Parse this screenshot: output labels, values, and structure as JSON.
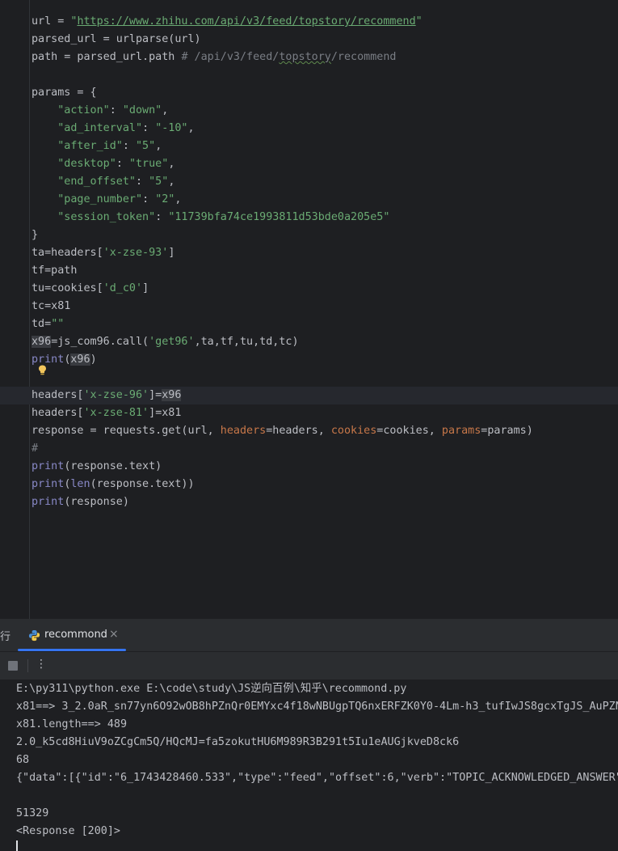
{
  "editor": {
    "url_var": "url",
    "url_value": "https://www.zhihu.com/api/v3/feed/topstory/recommend",
    "parse_call": "parsed_url = urlparse(url)",
    "path_assign": "path = parsed_url.path ",
    "path_comment_a": "# /api/v3/feed/",
    "path_comment_b": "topstory",
    "path_comment_c": "/recommend",
    "params_open": "params = {",
    "params": [
      {
        "key": "\"action\"",
        "value": "\"down\""
      },
      {
        "key": "\"ad_interval\"",
        "value": "\"-10\""
      },
      {
        "key": "\"after_id\"",
        "value": "\"5\""
      },
      {
        "key": "\"desktop\"",
        "value": "\"true\""
      },
      {
        "key": "\"end_offset\"",
        "value": "\"5\""
      },
      {
        "key": "\"page_number\"",
        "value": "\"2\""
      },
      {
        "key": "\"session_token\"",
        "value": "\"11739bfa74ce1993811d53bde0a205e5\""
      }
    ],
    "params_close": "}",
    "ta_prefix": "ta=headers[",
    "ta_key": "'x-zse-93'",
    "tf_line": "tf=path",
    "tu_prefix": "tu=cookies[",
    "tu_key": "'d_c0'",
    "tc_line": "tc=x81",
    "td_prefix": "td=",
    "td_value": "\"\"",
    "x96_var": "x96",
    "x96_call_a": "=js_com96.call(",
    "x96_call_str": "'get96'",
    "x96_call_b": ",ta,tf,tu,td,tc)",
    "print_kw": "print",
    "len_kw": "len",
    "x96": "x96",
    "headers_prefix": "headers[",
    "h96_key": "'x-zse-96'",
    "h81_key": "'x-zse-81'",
    "h81_rhs": "=x81",
    "resp_a": "response = requests.get(url, ",
    "kw_headers": "headers",
    "resp_b": "=headers, ",
    "kw_cookies": "cookies",
    "resp_c": "=cookies, ",
    "kw_params": "params",
    "resp_d": "=params)",
    "hash_comment": "#",
    "resp_text": "(response.text)",
    "resp_arg": "(response)"
  },
  "run_panel": {
    "label": "行",
    "tab_label": "recommond",
    "tab_close": "×",
    "more": "⋮",
    "output": [
      "E:\\py311\\python.exe E:\\code\\study\\JS逆向百例\\知乎\\recommond.py",
      "x81==> 3_2.0aR_sn77yn6O92wOB8hPZnQr0EMYxc4f18wNBUgpTQ6nxERFZK0Y0-4Lm-h3_tufIwJS8gcxTgJS_AuPZN",
      "x81.length==> 489",
      "2.0_k5cd8HiuV9oZCgCm5Q/HQcMJ=fa5zokutHU6M989R3B291t5Iu1eAUGjkveD8ck6",
      "68",
      "{\"data\":[{\"id\":\"6_1743428460.533\",\"type\":\"feed\",\"offset\":6,\"verb\":\"TOPIC_ACKNOWLEDGED_ANSWER\"",
      "",
      "51329",
      "<Response [200]>"
    ]
  },
  "colors": {
    "background": "#1e1f22",
    "panel": "#2b2d30",
    "keyword": "#cf8e6d",
    "string": "#6aab73",
    "builtin": "#8888c6",
    "accent": "#3574f0"
  },
  "icons": [
    "lightbulb-icon",
    "python-icon",
    "close-icon",
    "stop-icon",
    "more-vertical-icon"
  ]
}
